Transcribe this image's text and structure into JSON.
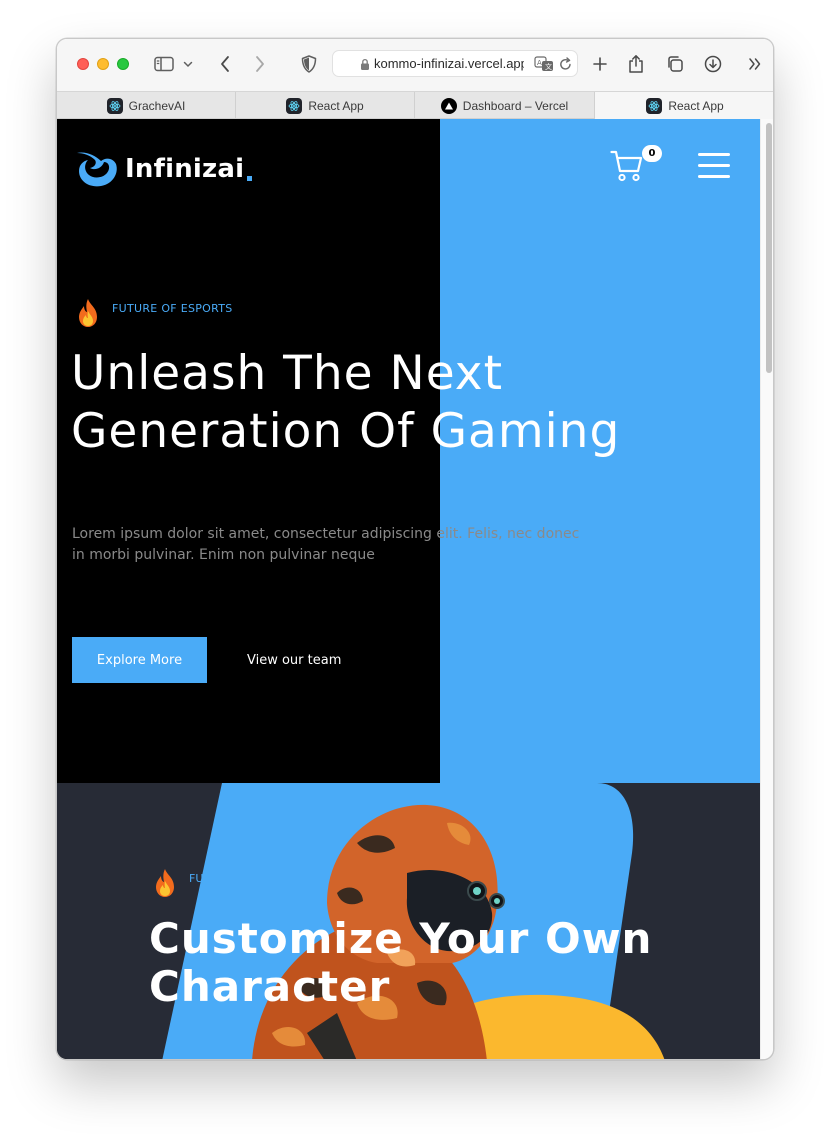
{
  "browser": {
    "url": "kommo-infinizai.vercel.app",
    "tabs": [
      {
        "label": "GrachevAI",
        "active": false
      },
      {
        "label": "React App",
        "active": false
      },
      {
        "label": "Dashboard – Vercel",
        "active": false
      },
      {
        "label": "React App",
        "active": true
      }
    ]
  },
  "site": {
    "logo_text": "Infinizai",
    "cart_count": "0",
    "colors": {
      "accent": "#4aabf7",
      "dark": "#272b36",
      "yellow": "#fbb82e"
    }
  },
  "hero": {
    "eyebrow": "FUTURE OF ESPORTS",
    "headline_line1": "Unleash The Next",
    "headline_line2": "Generation Of Gaming",
    "lead": "Lorem ipsum dolor sit amet, consectetur adipiscing elit. Felis, nec donec in morbi pulvinar. Enim non pulvinar neque",
    "primary_button": "Explore More",
    "secondary_link": "View our team"
  },
  "section2": {
    "eyebrow": "FU",
    "heading_line1": "Customize Your Own",
    "heading_line2": "Character"
  }
}
